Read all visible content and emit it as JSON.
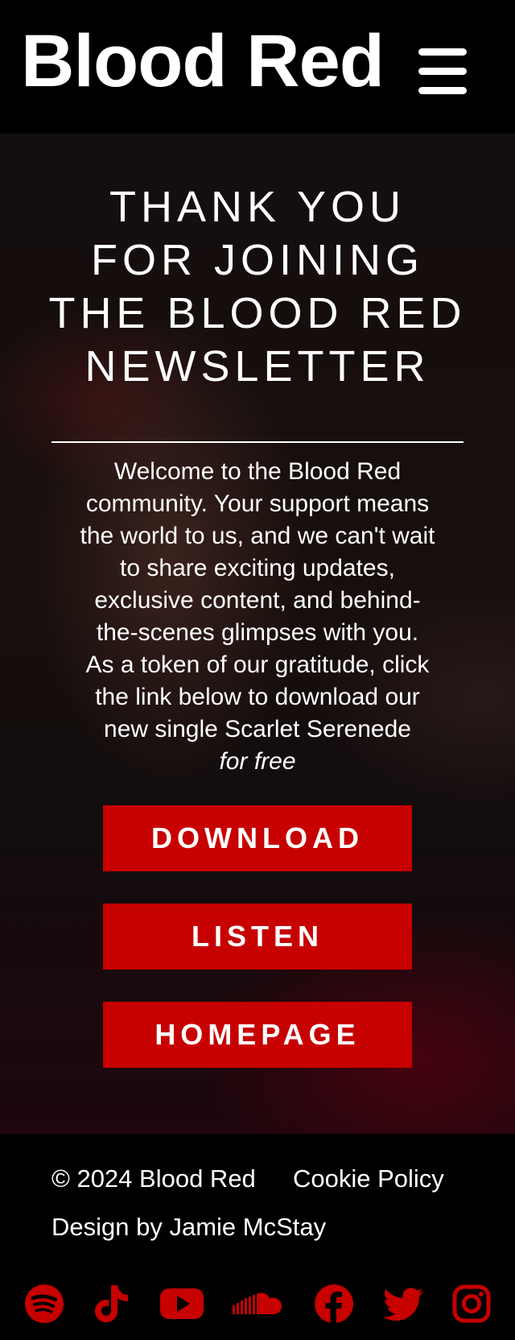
{
  "header": {
    "brand": "Blood Red",
    "menu_icon": "hamburger-menu-icon"
  },
  "hero": {
    "title_lines": [
      "THANK YOU",
      "FOR JOINING",
      "THE BLOOD RED",
      "NEWSLETTER"
    ],
    "body_lines": [
      "Welcome to the Blood Red",
      "community. Your support means",
      "the world to us, and we can't wait",
      "to share exciting updates,",
      "exclusive content, and behind-",
      "the-scenes glimpses with you.",
      "As a token of our gratitude, click",
      "the link below to download our",
      "new single Scarlet Serenede"
    ],
    "body_emphasis": "for free",
    "buttons": {
      "download": "DOWNLOAD",
      "listen": "LISTEN",
      "homepage": "HOMEPAGE"
    },
    "accent_color": "#c70000"
  },
  "footer": {
    "copyright": "© 2024 Blood Red",
    "cookie_policy": "Cookie Policy",
    "credit": "Design by Jamie McStay",
    "social_icons": [
      "spotify-icon",
      "tiktok-icon",
      "youtube-icon",
      "soundcloud-icon",
      "facebook-icon",
      "twitter-icon",
      "instagram-icon"
    ],
    "icon_color": "#c70000"
  }
}
